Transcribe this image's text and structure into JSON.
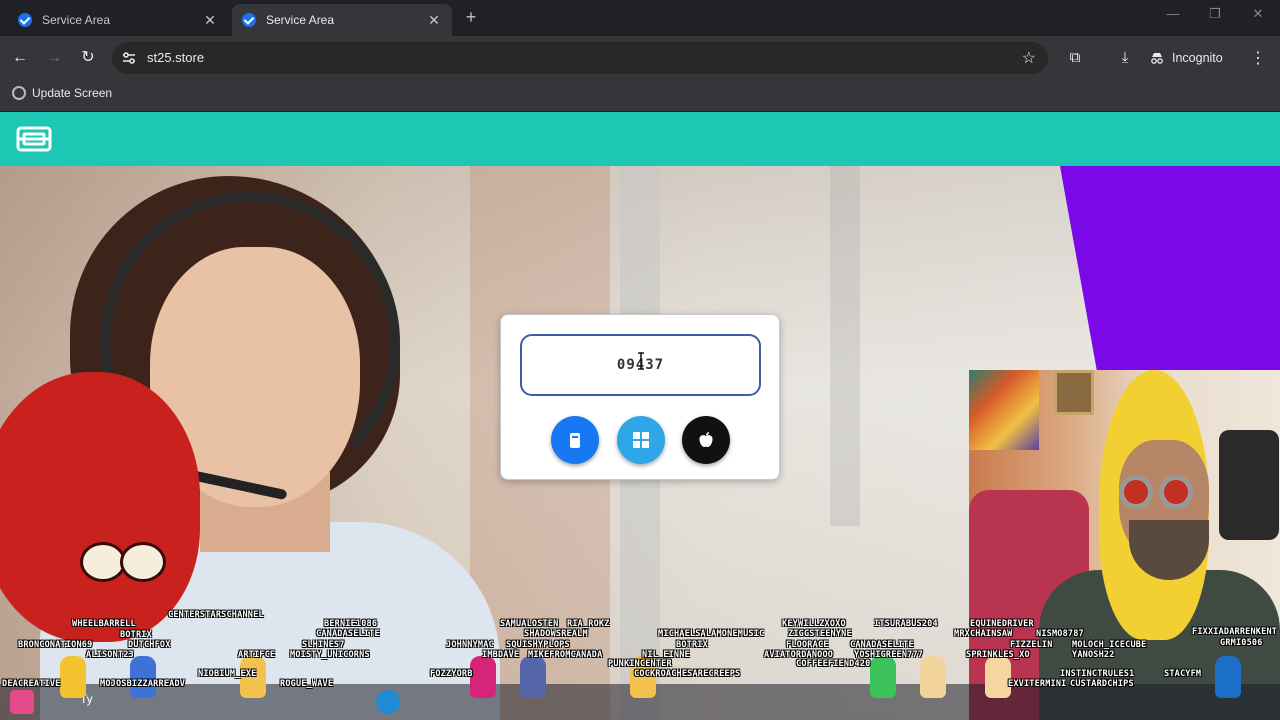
{
  "browser": {
    "tabs": [
      {
        "title": "Service Area",
        "active": false
      },
      {
        "title": "Service Area",
        "active": true
      }
    ],
    "address": "st25.store",
    "profile_label": "Incognito",
    "bookmarks": [
      {
        "label": "Update Screen"
      }
    ]
  },
  "page": {
    "code_display": "09437",
    "platform_buttons": [
      {
        "name": "android",
        "color": "#1877f2"
      },
      {
        "name": "windows",
        "color": "#2fa6e8"
      },
      {
        "name": "apple",
        "color": "#111111"
      }
    ],
    "brand_color": "#1ec6b4",
    "accent_color": "#7a08e8"
  },
  "overlay": {
    "chat_names": [
      {
        "text": "WHEELBARRELL"
      },
      {
        "text": "BOTRIX"
      },
      {
        "text": "BRONCONATION69"
      },
      {
        "text": "DUTCHFOX"
      },
      {
        "text": "ALISONT23"
      },
      {
        "text": "CENTERSTARSCHANNEL"
      },
      {
        "text": "BERNIE1086"
      },
      {
        "text": "CANADASELITE"
      },
      {
        "text": "SLHINES7"
      },
      {
        "text": "MOISTY_UNICORNS"
      },
      {
        "text": "ARTIFCE"
      },
      {
        "text": "NIOBIUM_EXE"
      },
      {
        "text": "ROGUE_WAVE"
      },
      {
        "text": "DEACREATIVE"
      },
      {
        "text": "MOJOSBIZZARREADV"
      },
      {
        "text": "SAMUALOSTEN"
      },
      {
        "text": "RIA_ROKZ"
      },
      {
        "text": "SHADOWSREALM"
      },
      {
        "text": "JOHNNYMAC"
      },
      {
        "text": "SQUISHYPLOPS"
      },
      {
        "text": "IMBDAVE"
      },
      {
        "text": "MIKEFROMCANADA"
      },
      {
        "text": "FOZZYORB"
      },
      {
        "text": "MICHAELSALAMONEMUSIC"
      },
      {
        "text": "BOTRIX"
      },
      {
        "text": "NIL_EINNE"
      },
      {
        "text": "PUNKINCENTER"
      },
      {
        "text": "COCKROACHESARECREEPS"
      },
      {
        "text": "KEYWILLZXOXO"
      },
      {
        "text": "ZIGGSTEENYNE"
      },
      {
        "text": "FLOORACE"
      },
      {
        "text": "AVIATORDANOOO"
      },
      {
        "text": "COFFEEFIEND420"
      },
      {
        "text": "ITSURABUS204"
      },
      {
        "text": "CANADASELITE"
      },
      {
        "text": "YOSHIGREEN777"
      },
      {
        "text": "EQUINEDRIVER"
      },
      {
        "text": "MRXCHAINSAW"
      },
      {
        "text": "NISMO8787"
      },
      {
        "text": "FIZZELIN"
      },
      {
        "text": "MOLOCH_ICECUBE"
      },
      {
        "text": "SPRINKLES_XO"
      },
      {
        "text": "YANOSH22"
      },
      {
        "text": "INSTINCTRULES1"
      },
      {
        "text": "EXVITERMINI"
      },
      {
        "text": "CUSTARDCHIPS"
      },
      {
        "text": "STACYFM"
      },
      {
        "text": "FIXXIADARRENKENT"
      },
      {
        "text": "GRMI0506"
      }
    ],
    "taskbar_search": "Ty"
  }
}
